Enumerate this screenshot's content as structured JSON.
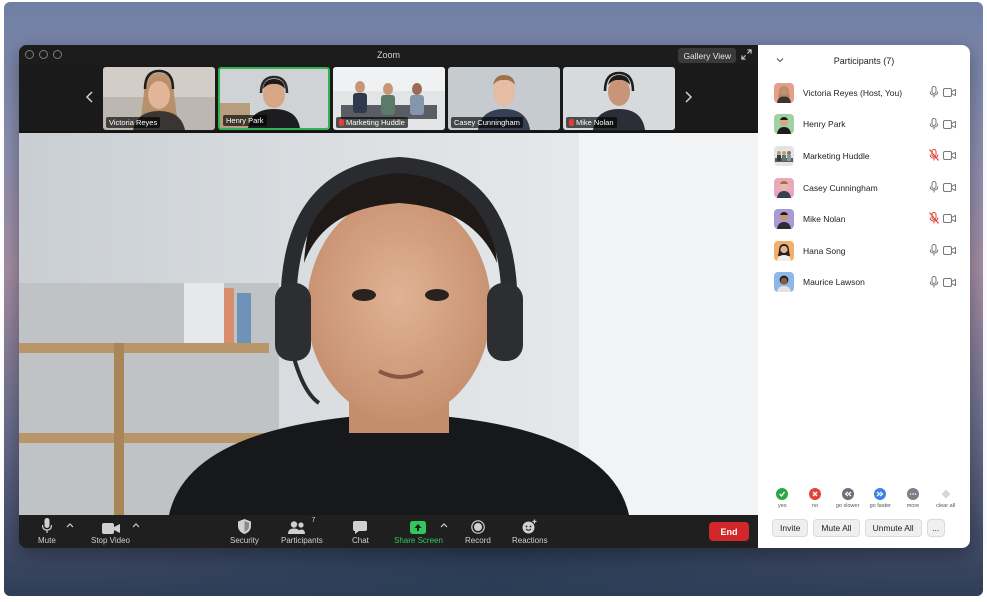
{
  "window": {
    "title": "Zoom",
    "view_button": "Gallery View"
  },
  "thumbnails": [
    {
      "name": "Victoria Reyes",
      "muted": false,
      "active": false
    },
    {
      "name": "Henry Park",
      "muted": false,
      "active": true
    },
    {
      "name": "Marketing Huddle",
      "muted": true,
      "active": false
    },
    {
      "name": "Casey Cunningham",
      "muted": false,
      "active": false
    },
    {
      "name": "Mike Nolan",
      "muted": true,
      "active": false
    }
  ],
  "controls": {
    "mute": "Mute",
    "stop_video": "Stop Video",
    "security": "Security",
    "participants": "Participants",
    "participants_count": "7",
    "chat": "Chat",
    "share_screen": "Share Screen",
    "record": "Record",
    "reactions": "Reactions",
    "end": "End"
  },
  "panel": {
    "title": "Participants (7)",
    "participants": [
      {
        "name": "Victoria Reyes (Host, You)",
        "mic_muted": false,
        "avatar_color": "#e7a088"
      },
      {
        "name": "Henry Park",
        "mic_muted": false,
        "avatar_color": "#9fd2a2"
      },
      {
        "name": "Marketing Huddle",
        "mic_muted": true,
        "avatar_color": "#b8bcc2"
      },
      {
        "name": "Casey Cunningham",
        "mic_muted": false,
        "avatar_color": "#eba8b8"
      },
      {
        "name": "Mike Nolan",
        "mic_muted": true,
        "avatar_color": "#a99bd6"
      },
      {
        "name": "Hana Song",
        "mic_muted": false,
        "avatar_color": "#f0b06c"
      },
      {
        "name": "Maurice Lawson",
        "mic_muted": false,
        "avatar_color": "#8fb8e8"
      }
    ],
    "feedback": [
      {
        "label": "yes",
        "color": "#27a844"
      },
      {
        "label": "no",
        "color": "#e0443a"
      },
      {
        "label": "go slower",
        "color": "#6a6f7a"
      },
      {
        "label": "go faster",
        "color": "#3d82e6"
      },
      {
        "label": "more",
        "color": "#7a7f88"
      },
      {
        "label": "clear all",
        "color": "#d6d6d6"
      }
    ],
    "actions": {
      "invite": "Invite",
      "mute_all": "Mute All",
      "unmute_all": "Unmute All",
      "more": "..."
    }
  },
  "colors": {
    "accent_green": "#33c65a",
    "end_red": "#d1272b"
  }
}
